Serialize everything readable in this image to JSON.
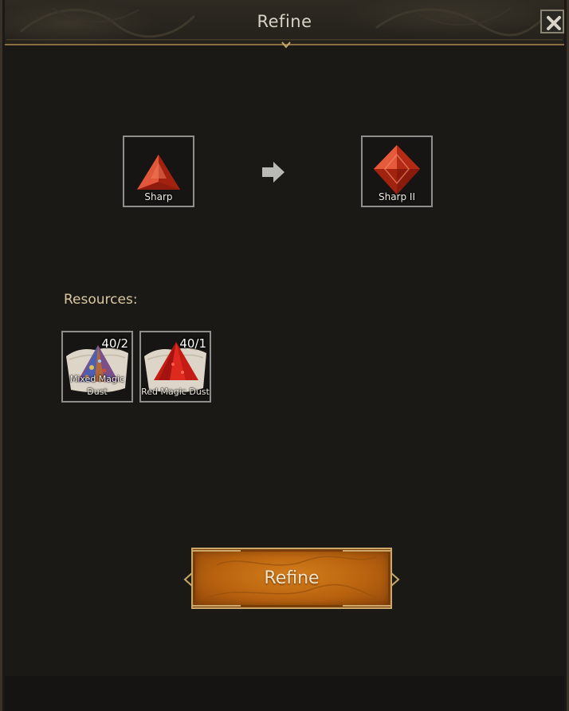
{
  "window": {
    "title": "Refine",
    "close_icon": "close-icon"
  },
  "upgrade": {
    "source": {
      "label": "Sharp",
      "icon": "red-triangle-gem-icon"
    },
    "arrow_icon": "arrow-right-icon",
    "target": {
      "label": "Sharp II",
      "icon": "red-diamond-gem-icon"
    }
  },
  "resources": {
    "heading": "Resources:",
    "items": [
      {
        "label": "Mixed Magic Dust",
        "count": "40/2",
        "icon": "mixed-dust-pile-icon"
      },
      {
        "label": "Red Magic Dust",
        "count": "40/1",
        "icon": "red-dust-pile-icon"
      }
    ]
  },
  "actions": {
    "refine_label": "Refine"
  },
  "colors": {
    "accent_gold": "#c9a86a",
    "button_orange": "#c76d14",
    "panel_bg": "#1b1915"
  }
}
